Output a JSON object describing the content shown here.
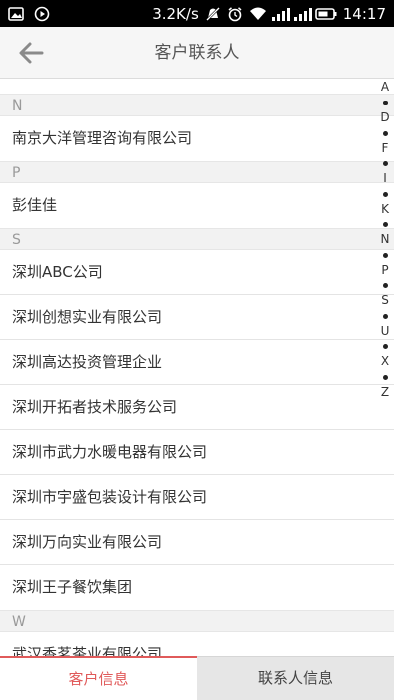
{
  "status_bar": {
    "speed": "3.2K/s",
    "time": "14:17"
  },
  "header": {
    "title": "客户联系人"
  },
  "sections": [
    {
      "letter": "N",
      "items": [
        "南京大洋管理咨询有限公司"
      ]
    },
    {
      "letter": "P",
      "items": [
        "彭佳佳"
      ]
    },
    {
      "letter": "S",
      "items": [
        "深圳ABC公司",
        "深圳创想实业有限公司",
        "深圳高达投资管理企业",
        "深圳开拓者技术服务公司",
        "深圳市武力水暖电器有限公司",
        "深圳市宇盛包装设计有限公司",
        "深圳万向实业有限公司",
        "深圳王子餐饮集团"
      ]
    },
    {
      "letter": "W",
      "items": [
        "武汉香茗茶业有限公司"
      ]
    }
  ],
  "index_bar": [
    "A",
    "D",
    "F",
    "I",
    "K",
    "N",
    "P",
    "S",
    "U",
    "X",
    "Z"
  ],
  "tabs": {
    "customer_info": "客户信息",
    "contact_info": "联系人信息"
  },
  "colors": {
    "accent": "#e05a5a",
    "statusbar_bg": "#000000",
    "header_bg": "#f6f6f6",
    "section_bg": "#f2f2f2"
  }
}
